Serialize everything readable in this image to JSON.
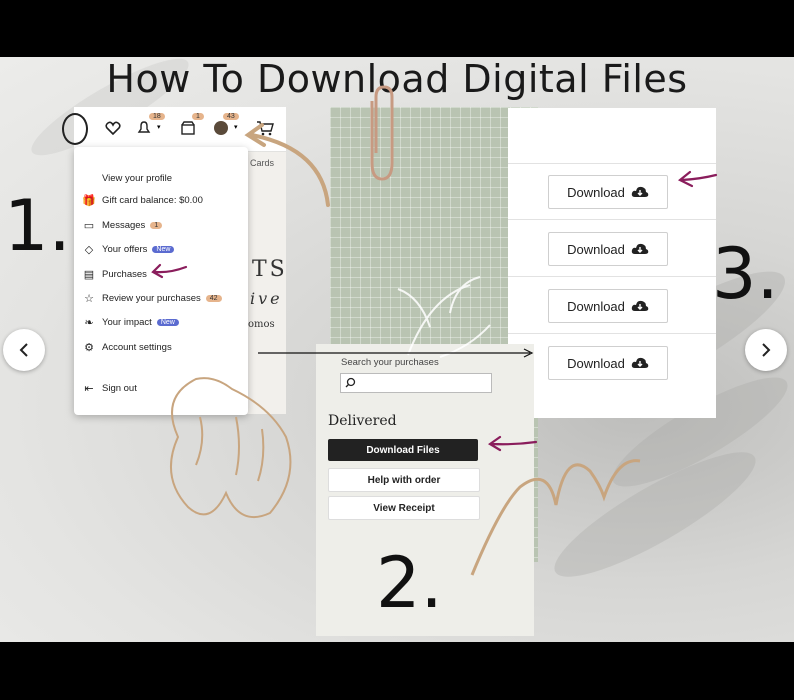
{
  "title": "How To Download Digital Files",
  "steps": {
    "one": "1.",
    "two": "2.",
    "three": "3."
  },
  "header_icons": {
    "notifications_count": "18",
    "shop_count": "1",
    "account_count": "43",
    "cards_text": "Cards"
  },
  "menu": {
    "view_profile": "View your profile",
    "gift_card": "Gift card balance: $0.00",
    "messages": "Messages",
    "messages_badge": "1",
    "offers": "Your offers",
    "offers_badge": "New",
    "purchases": "Purchases",
    "review": "Review your purchases",
    "review_badge": "42",
    "impact": "Your impact",
    "impact_badge": "New",
    "account_settings": "Account settings",
    "sign_out": "Sign out"
  },
  "promo": {
    "line1": "TS",
    "line2": "ive",
    "line3": "omos"
  },
  "purchases_panel": {
    "search_label": "Search your purchases",
    "search_value": "",
    "delivered": "Delivered",
    "download_files": "Download Files",
    "help": "Help with order",
    "view_receipt": "View Receipt"
  },
  "downloads": [
    "Download",
    "Download",
    "Download",
    "Download"
  ],
  "colors": {
    "accent_arrow": "#8a1d5c",
    "badge_orange": "#e6b48c",
    "badge_blue": "#5b6bd0",
    "sage": "#b9c4b2",
    "tan": "#c8a57f"
  },
  "icons": [
    "heart-icon",
    "bell-icon",
    "shop-icon",
    "avatar-icon",
    "cart-icon",
    "cloud-download-icon",
    "chevron-left-icon",
    "chevron-right-icon",
    "search-icon"
  ]
}
